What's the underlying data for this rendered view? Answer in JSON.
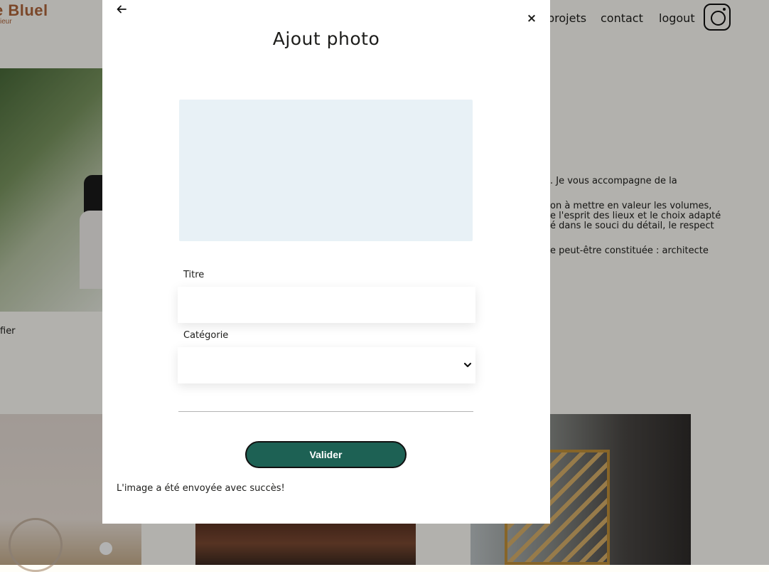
{
  "header": {
    "logo": "e Bluel",
    "logo_sub": "ieur",
    "nav": [
      "projets",
      "contact",
      "logout"
    ],
    "instagram_icon": "instagram-icon"
  },
  "background": {
    "modifier_text": "fier",
    "bio": [
      ". Je vous accompagne de la",
      "on à mettre en valeur les volumes,",
      "e l'esprit des lieux et le choix adapté",
      "é dans le souci du détail, le respect",
      "e peut-être constituée : architecte"
    ]
  },
  "modal": {
    "back_icon": "arrow-left-icon",
    "close_label": "×",
    "title": "Ajout photo",
    "titre_label": "Titre",
    "titre_value": "",
    "categorie_label": "Catégorie",
    "categorie_value": "",
    "submit_label": "Valider",
    "success_message": "L'image a été envoyée avec succès!"
  },
  "colors": {
    "accent": "#1d6154",
    "logo": "#b1663c",
    "dropzone": "#e8f1f6"
  }
}
